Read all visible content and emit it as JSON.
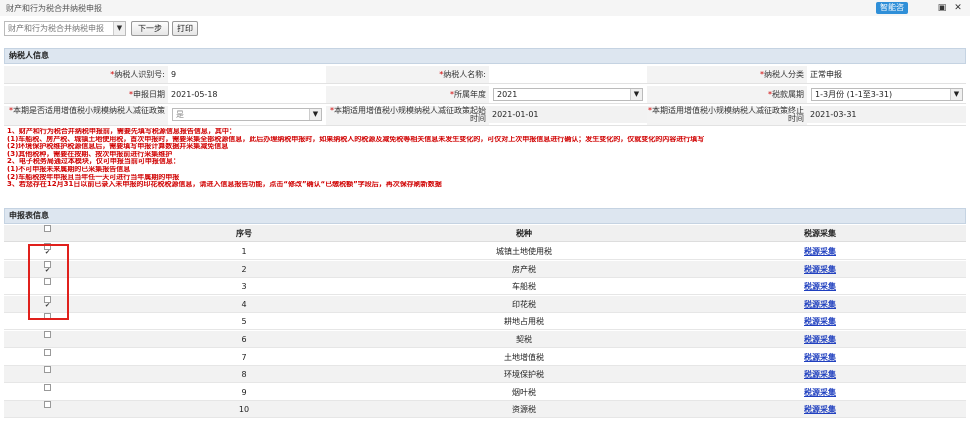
{
  "window": {
    "title": "财产和行为税合并纳税申报",
    "assistant_label": "智能咨",
    "pin_icon": "pin-icon",
    "close_icon": "close-icon"
  },
  "toolbar": {
    "report_select_value": "财产和行为税合并纳税申报",
    "next_label": "下一步",
    "print_label": "打印"
  },
  "taxpayer": {
    "section_title": "纳税人信息",
    "id_label": "纳税人识别号:",
    "id_value": "9",
    "name_label": "纳税人名称:",
    "name_value": "",
    "category_label": "纳税人分类",
    "category_value": "正常申报",
    "date_label": "申报日期",
    "date_value": "2021-05-18",
    "year_label": "所属年度",
    "year_value": "2021",
    "period_label": "税款属期",
    "period_value": "1-3月份 (1-1至3-31)",
    "relief_label": "本期是否适用增值税小规模纳税人减征政策",
    "relief_value": "是",
    "relief_start_label": "本期适用增值税小规模纳税人减征政策起始时间",
    "relief_start_value": "2021-01-01",
    "relief_end_label": "本期适用增值税小规模纳税人减征政策终止时间",
    "relief_end_value": "2021-03-31"
  },
  "notice_lines": [
    "1、财产和行为税合并纳税申报前，需要先填写税源信息报告信息，其中：",
    "(1)车船税、房产税、城镇土地使用税，首次申报时，需要采集全部税源信息，此后办理纳税申报时，如果纳税人的税源及减免税等相关信息未发生变化的，可仅对上次申报信息进行确认；发生变化的，仅就变化的内容进行填写",
    "(2)环境保护税维护税源信息后，需要填写申报计算数据并采集减免信息",
    "(3)其他税种，需要在按期、按次申报前进行采集维护",
    "2、电子税务局通过本模块，仅可申报当前可申报信息：",
    "(1)不可申报未来属期的已采集报告信息",
    "(2)车船税按年申报且当年任一天可进行当年属期的申报",
    "3、若您存在12月31日以前已录入未申报的印花税税源信息，请进入信息报告功能，点击“修改”确认“已缴税额”字段后，再次保存刷新数据"
  ],
  "report_table": {
    "section_title": "申报表信息",
    "columns": [
      "序号",
      "税种",
      "税源采集"
    ],
    "rows": [
      {
        "no": "1",
        "tax": "城镇土地使用税",
        "link": "税源采集",
        "checked": true
      },
      {
        "no": "2",
        "tax": "房产税",
        "link": "税源采集",
        "checked": true
      },
      {
        "no": "3",
        "tax": "车船税",
        "link": "税源采集",
        "checked": false
      },
      {
        "no": "4",
        "tax": "印花税",
        "link": "税源采集",
        "checked": true
      },
      {
        "no": "5",
        "tax": "耕地占用税",
        "link": "税源采集",
        "checked": false
      },
      {
        "no": "6",
        "tax": "契税",
        "link": "税源采集",
        "checked": false
      },
      {
        "no": "7",
        "tax": "土地增值税",
        "link": "税源采集",
        "checked": false
      },
      {
        "no": "8",
        "tax": "环境保护税",
        "link": "税源采集",
        "checked": false
      },
      {
        "no": "9",
        "tax": "烟叶税",
        "link": "税源采集",
        "checked": false
      },
      {
        "no": "10",
        "tax": "资源税",
        "link": "税源采集",
        "checked": false
      }
    ]
  },
  "colors": {
    "highlight_border": "#e0201c",
    "notice_text": "#d00000",
    "link": "#1f3fbf"
  }
}
